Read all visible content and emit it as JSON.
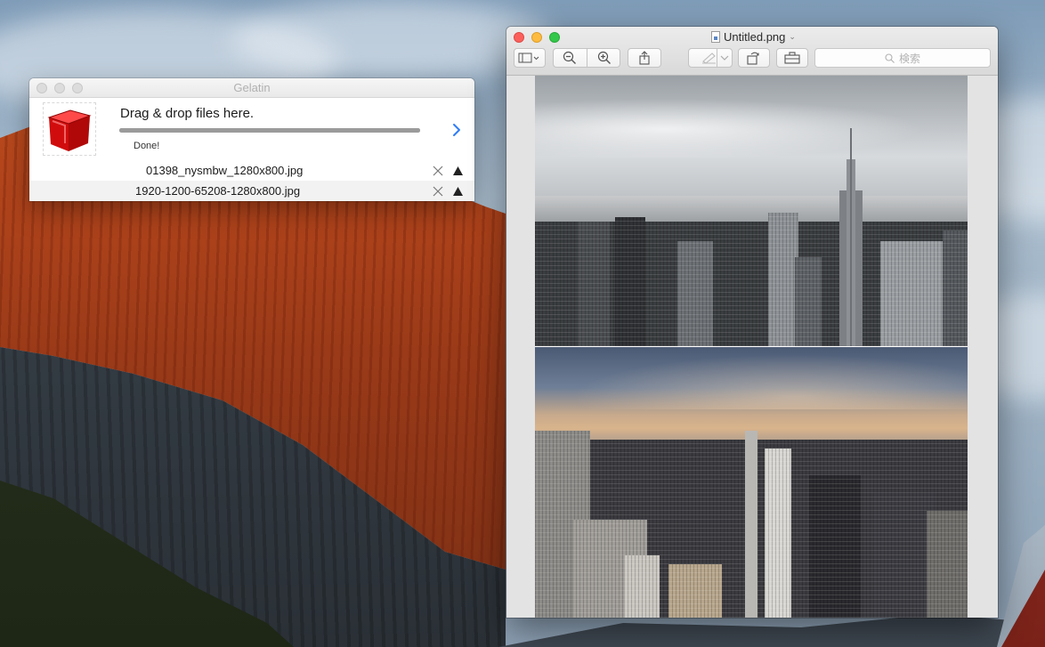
{
  "desktop": {
    "wallpaper": "El Capitan"
  },
  "gelatin": {
    "title": "Gelatin",
    "headline": "Drag & drop files here.",
    "status": "Done!",
    "progress": 1.0,
    "files": [
      {
        "name": "01398_nysmbw_1280x800.jpg"
      },
      {
        "name": "1920-1200-65208-1280x800.jpg"
      }
    ],
    "icons": {
      "app_icon": "red-cube-icon",
      "next": "chevron-right-icon",
      "remove": "close-icon",
      "upload": "upload-triangle-icon"
    },
    "colors": {
      "accent": "#2f7cf6",
      "cube": "#d80f0f"
    }
  },
  "preview": {
    "title": "Untitled.png",
    "search_placeholder": "検索",
    "toolbar": {
      "sidebar": "sidebar-icon",
      "zoom_out": "zoom-out-icon",
      "zoom_in": "zoom-in-icon",
      "share": "share-icon",
      "markup": "pen-icon",
      "rotate": "rotate-icon",
      "toolbox": "toolbox-icon"
    },
    "images": [
      {
        "description_name": "bw-nyc-skyline-photo"
      },
      {
        "description_name": "color-nyc-skyline-photo"
      }
    ],
    "colors": {
      "close": "#fc605c",
      "minimize": "#fdbc40",
      "zoom": "#34c84a"
    }
  }
}
